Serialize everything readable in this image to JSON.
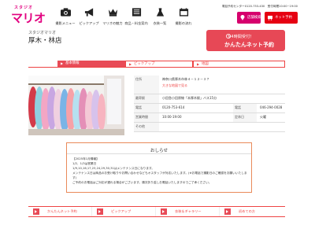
{
  "header": {
    "logo_small": "スタジオ",
    "logo_big": "マリオ",
    "nav": [
      {
        "label": "撮影メニュー",
        "icon": "camera-icon"
      },
      {
        "label": "ピックアップ",
        "icon": "megaphone-icon"
      },
      {
        "label": "マリオの魅力",
        "icon": "crown-icon"
      },
      {
        "label": "商品・料金案内",
        "icon": "book-icon"
      },
      {
        "label": "衣装一覧",
        "icon": "dress-icon"
      },
      {
        "label": "撮影の流れ",
        "icon": "calendar-icon"
      }
    ],
    "tel_text": "電話予約センター0120-753-430　受付時間10:00~19:00",
    "shop_button": "店舗検索",
    "net_button": "ネット予約"
  },
  "shop": {
    "kana": "スタジオマリオ",
    "name": "厚木・林店"
  },
  "cta": {
    "line1": "24時間受付！",
    "line2": "かんたんネット予約"
  },
  "tabs": [
    {
      "label": "基本情報"
    },
    {
      "label": "ピックアップ"
    },
    {
      "label": "地図"
    }
  ],
  "info": {
    "address_label": "住所",
    "address": "神奈川県厚木市林４－１２－３７",
    "map_link": "大きな地図で見る",
    "station_label": "最寄駅",
    "station": "小田急小田原線「本厚木駅」バス15分",
    "phone_label": "電話",
    "phone": "0120-753-614",
    "fax_label": "電話",
    "fax": "046-294-0028",
    "hours_label": "営業時間",
    "hours": "10:00-19:00",
    "closed_label": "定休日",
    "closed": "火曜",
    "other_label": "その他",
    "other": ""
  },
  "notice": {
    "title": "おしらせ",
    "lines": [
      "【2025年1月情報】",
      "1/2、1/3は営業日",
      "1/9,10,16,17,23,24,29,30,31はメンテナンス日になります。",
      "メンテナンス日は商品のお受け取りやお問い合わせなどもオスタッフが対応いたします。(※お電話で撮影日のご確認をお願いいたします)",
      "ご予約のお電話はご対応が遅れる場合がございます。順次折り返しお電話いたしますのでご了承ください。"
    ]
  },
  "footer_nav": [
    {
      "label": "かんたんネット予約"
    },
    {
      "label": "ピックアップ"
    },
    {
      "label": "衣装＆ギャラリー"
    },
    {
      "label": "初めての方"
    }
  ],
  "colors": {
    "brand": "#e2007f",
    "accent": "#e84b57",
    "cta": "#e74856"
  }
}
